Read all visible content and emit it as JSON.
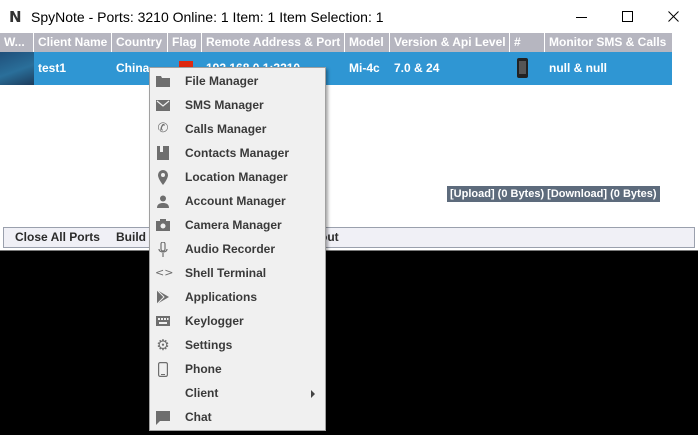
{
  "window": {
    "app_icon_letter": "N",
    "title": "SpyNote - Ports: 3210 Online: 1 Item: 1 Item Selection: 1",
    "minimize_icon": "minimize-icon",
    "maximize_icon": "maximize-icon",
    "close_icon": "close-icon"
  },
  "table": {
    "headers": [
      "W...",
      "Client Name",
      "Country",
      "Flag",
      "Remote Address & Port",
      "Model",
      "Version & Api Level",
      "#",
      "Monitor SMS & Calls"
    ],
    "row": {
      "wallpaper": "wallpaper-thumbnail",
      "client_name": "test1",
      "country": "China",
      "flag": "china-flag-icon",
      "remote_address": "192.168.0.1:3210",
      "model": "Mi-4c",
      "version": "7.0 & 24",
      "device_icon": "phone-icon",
      "monitor": "null & null"
    }
  },
  "transfer_status": "[Upload] (0 Bytes) [Download] (0 Bytes)",
  "bottom_bar": {
    "close_all_ports": "Close All Ports",
    "build_client": "Build C",
    "about": "out"
  },
  "context_menu": {
    "items": [
      {
        "label": "File Manager",
        "icon": "folder-icon"
      },
      {
        "label": "SMS Manager",
        "icon": "envelope-icon"
      },
      {
        "label": "Calls Manager",
        "icon": "phone-handset-icon"
      },
      {
        "label": "Contacts Manager",
        "icon": "contacts-book-icon"
      },
      {
        "label": "Location Manager",
        "icon": "location-pin-icon"
      },
      {
        "label": "Account Manager",
        "icon": "person-icon"
      },
      {
        "label": "Camera Manager",
        "icon": "camera-icon"
      },
      {
        "label": "Audio Recorder",
        "icon": "microphone-icon"
      },
      {
        "label": "Shell Terminal",
        "icon": "code-brackets-icon"
      },
      {
        "label": "Applications",
        "icon": "play-store-icon"
      },
      {
        "label": "Keylogger",
        "icon": "keyboard-icon"
      },
      {
        "label": "Settings",
        "icon": "gear-icon"
      },
      {
        "label": "Phone",
        "icon": "smartphone-icon"
      },
      {
        "label": "Client",
        "icon": "",
        "submenu": true
      },
      {
        "label": "Chat",
        "icon": "chat-bubble-icon"
      }
    ]
  }
}
